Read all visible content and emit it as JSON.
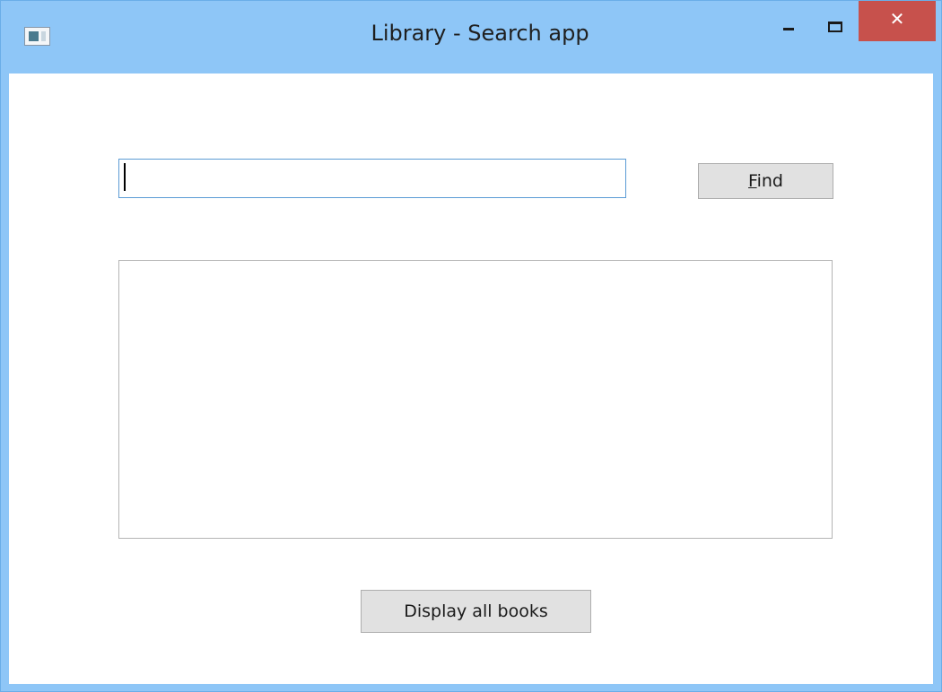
{
  "window": {
    "title": "Library - Search app",
    "controls": {
      "minimize_icon": "minimize-icon",
      "maximize_icon": "maximize-icon",
      "close_icon": "close-icon",
      "close_glyph": "✕"
    },
    "colors": {
      "frame": "#8ec6f7",
      "close_button": "#c7514c",
      "input_focus_border": "#5b9bd5",
      "button_face": "#e1e1e1"
    }
  },
  "search": {
    "value": "",
    "placeholder": ""
  },
  "find_button": {
    "mnemonic": "F",
    "rest": "ind"
  },
  "results": {
    "items": []
  },
  "display_all_button": {
    "label": "Display all books"
  }
}
